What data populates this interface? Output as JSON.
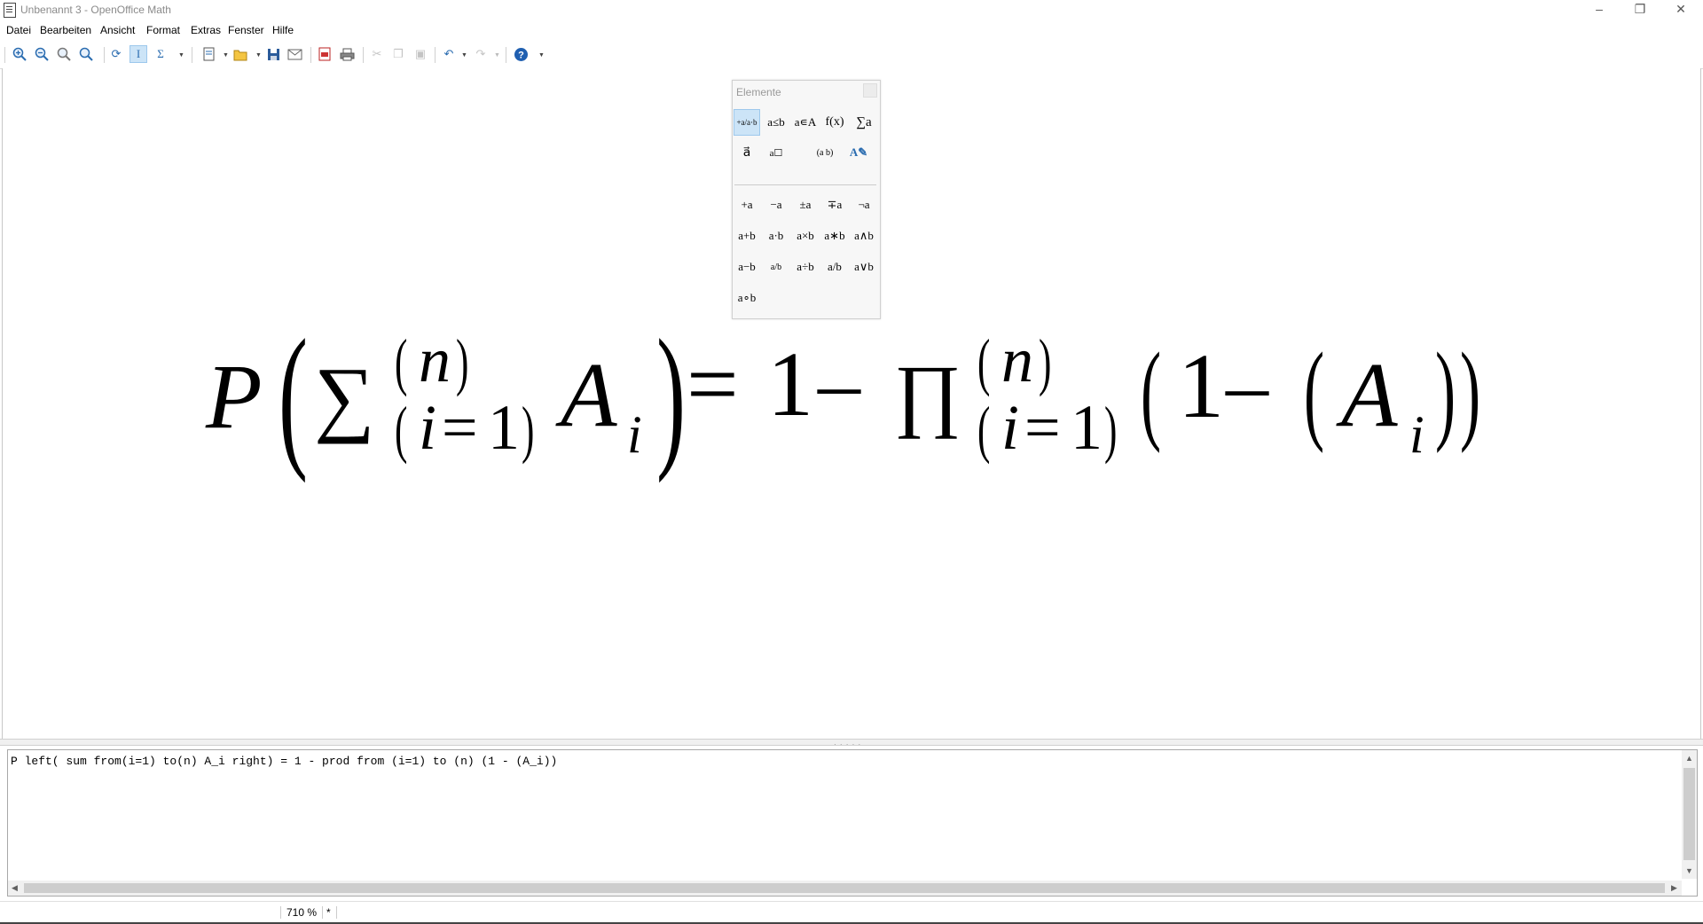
{
  "window": {
    "title": "Unbenannt 3 - OpenOffice Math",
    "controls": {
      "minimize": "–",
      "restore": "❐",
      "close": "✕"
    }
  },
  "menu": [
    "Datei",
    "Bearbeiten",
    "Ansicht",
    "Format",
    "Extras",
    "Fenster",
    "Hilfe"
  ],
  "toolbar": {
    "icons": [
      "zoom-in-icon",
      "zoom-out-icon",
      "zoom-100-icon",
      "zoom-icon",
      "update-icon",
      "formula-cursor-icon",
      "symbols-icon",
      "new-icon",
      "open-icon",
      "save-icon",
      "email-icon",
      "pdf-icon",
      "print-icon",
      "cut-icon",
      "copy-icon",
      "paste-icon",
      "undo-icon",
      "redo-icon",
      "help-icon"
    ],
    "active": "formula-cursor-icon"
  },
  "elements_panel": {
    "title": "Elemente",
    "categories": [
      "+a/a·b",
      "a≤b",
      "a∊A",
      "f(x)",
      "∑a",
      "a⃗",
      "a☐",
      "(a b)",
      "A✎"
    ],
    "selected_category": "+a/a·b",
    "items": [
      "+a",
      "−a",
      "±a",
      "∓a",
      "¬a",
      "a+b",
      "a·b",
      "a×b",
      "a∗b",
      "a∧b",
      "a−b",
      "a/b",
      "a÷b",
      "a/b",
      "a∨b",
      "a∘b"
    ]
  },
  "formula": {
    "command": "P left( sum from(i=1) to(n) A_i right) = 1 - prod from (i=1) to (n) (1 - (A_i))",
    "parts": {
      "P": "P",
      "lparen": "(",
      "rparen": ")",
      "sum": "∑",
      "prod": "∏",
      "n": "n",
      "i": "i",
      "eq": "=",
      "one": "1",
      "A": "A",
      "minus": "–"
    }
  },
  "status": {
    "zoom": "710 %",
    "modified": "*"
  }
}
